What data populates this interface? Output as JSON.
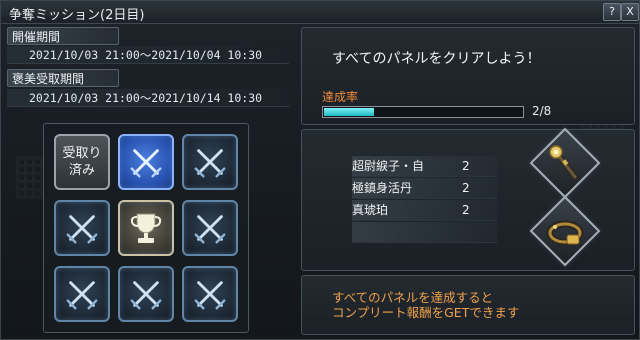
{
  "window": {
    "title": "争奪ミッション(2日目)",
    "help_label": "?",
    "close_label": "X"
  },
  "periods": {
    "event_label": "開催期間",
    "event_value": "2021/10/03 21:00～2021/10/04 10:30",
    "reward_label": "褒美受取期間",
    "reward_value": "2021/10/03 21:00～2021/10/14 10:30"
  },
  "panels": {
    "claimed_line1": "受取り",
    "claimed_line2": "済み",
    "tiles": [
      {
        "state": "claimed",
        "icon": "claimed-label"
      },
      {
        "state": "highlight",
        "icon": "crossed-swords-icon"
      },
      {
        "state": "normal",
        "icon": "crossed-swords-icon"
      },
      {
        "state": "normal",
        "icon": "crossed-swords-icon"
      },
      {
        "state": "trophy",
        "icon": "trophy-icon"
      },
      {
        "state": "normal",
        "icon": "crossed-swords-icon"
      },
      {
        "state": "normal",
        "icon": "crossed-swords-icon"
      },
      {
        "state": "normal",
        "icon": "crossed-swords-icon"
      },
      {
        "state": "normal",
        "icon": "crossed-swords-icon"
      }
    ]
  },
  "mission": {
    "text": "すべてのパネルをクリアしよう！",
    "rate_label": "達成率",
    "progress_text": "2/8",
    "progress_fraction": 0.25,
    "progress_color": "#3fd3dd"
  },
  "rewards": {
    "items": [
      {
        "name": "超尉綟子・自",
        "qty": "2"
      },
      {
        "name": "極鎮身活丹",
        "qty": "2"
      },
      {
        "name": "真琥珀",
        "qty": "2"
      }
    ],
    "icons": [
      "staff-icon",
      "bracelet-icon"
    ]
  },
  "completion": {
    "line1": "すべてのパネルを達成すると",
    "line2": "コンプリート報酬をGETできます"
  },
  "colors": {
    "accent_orange": "#f08a3a",
    "note_orange": "#f0a14a",
    "tile_blue": "#2852b0"
  }
}
